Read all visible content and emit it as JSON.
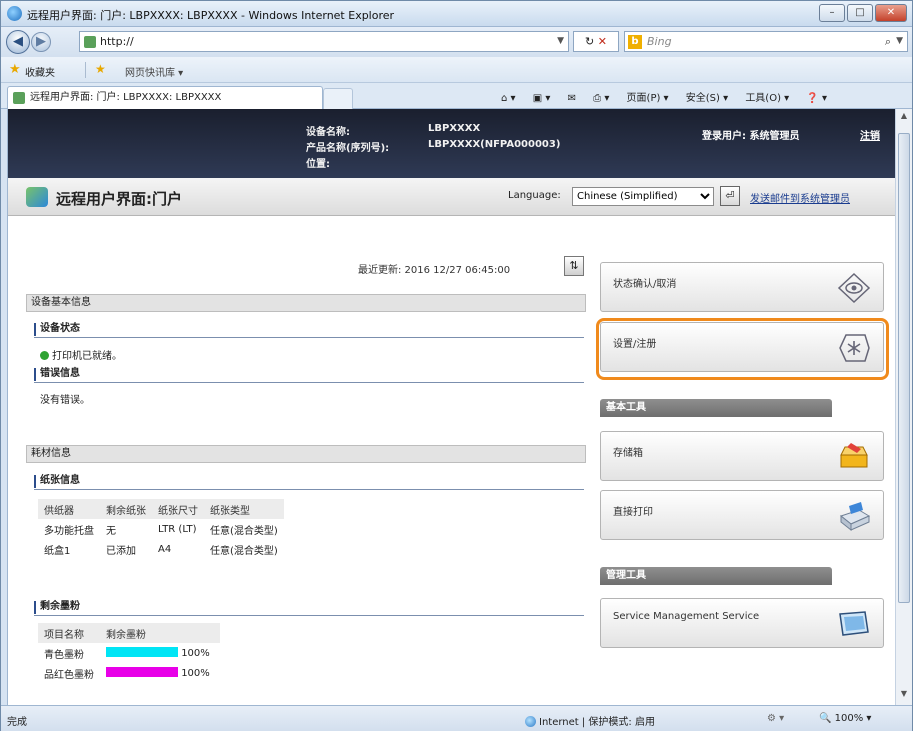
{
  "window": {
    "title": "远程用户界面: 门户: LBPXXXX: LBPXXXX - Windows Internet Explorer",
    "min": "–",
    "max": "□",
    "close": "✕"
  },
  "addressbar": {
    "url": "http://",
    "search_placeholder": "Bing"
  },
  "favorites": {
    "label": "收藏夹",
    "suggest": "网页快讯库 ▾"
  },
  "tab": {
    "title": "远程用户界面: 门户: LBPXXXX: LBPXXXX"
  },
  "commands": {
    "page": "页面(P) ▾",
    "safety": "安全(S) ▾",
    "tools": "工具(O) ▾",
    "help": "❓ ▾"
  },
  "header": {
    "device_name_key": "设备名称:",
    "device_name_val": "LBPXXXX",
    "product_name_key": "产品名称(序列号):",
    "product_name_val": "LBPXXXX(NFPA000003)",
    "location_key": "位置:",
    "login_user": "登录用户: 系统管理员",
    "logout": "注销"
  },
  "portal": {
    "title": "远程用户界面:门户",
    "language_label": "Language:",
    "language_value": "Chinese (Simplified)",
    "mail_link": "发送邮件到系统管理员"
  },
  "main": {
    "last_updated": "最近更新: 2016 12/27 06:45:00",
    "basic_info": "设备基本信息",
    "device_status_head": "设备状态",
    "device_status": "打印机已就绪。",
    "error_head": "错误信息",
    "error_text": "没有错误。",
    "consumables": "耗材信息",
    "paper_head": "纸张信息",
    "paper_columns": [
      "供纸器",
      "剩余纸张",
      "纸张尺寸",
      "纸张类型"
    ],
    "paper_rows": [
      [
        "多功能托盘",
        "无",
        "LTR (LT)",
        "任意(混合类型)"
      ],
      [
        "纸盒1",
        "已添加",
        "A4",
        "任意(混合类型)"
      ]
    ],
    "toner_head": "剩余墨粉",
    "toner_columns": [
      "项目名称",
      "剩余墨粉"
    ],
    "toner_rows": [
      {
        "name": "青色墨粉",
        "percent": "100%",
        "color": "#00e5f5"
      },
      {
        "name": "品红色墨粉",
        "percent": "100%",
        "color": "#e800e8"
      }
    ]
  },
  "right": {
    "status_btn": "状态确认/取消",
    "settings_btn": "设置/注册",
    "basic_tools": "基本工具",
    "mailbox_btn": "存储箱",
    "direct_print_btn": "直接打印",
    "mgmt_tools": "管理工具",
    "sms_btn": "Service Management Service"
  },
  "statusbar": {
    "left": "完成",
    "zone": "Internet | 保护模式: 启用",
    "zoom": "100%"
  }
}
